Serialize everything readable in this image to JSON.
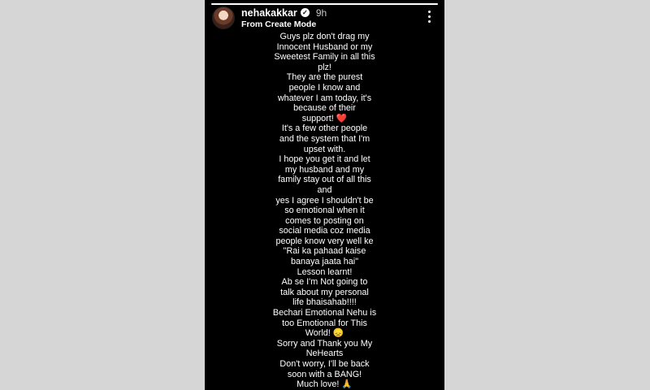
{
  "story": {
    "progress": 1.0,
    "header": {
      "username": "nehakakkar",
      "verified_glyph": "✓",
      "time": "9h",
      "subtitle": "From Create Mode"
    },
    "caption_lines": [
      "Guys plz don't drag my",
      "Innocent Husband or my",
      "Sweetest Family in all this",
      "plz!",
      "They are the purest",
      "people I know and",
      "whatever I am today, it's",
      "because of their",
      "support! ❤️",
      "It's a few other people",
      "and the system that I'm",
      "upset with.",
      "I hope you get it and let",
      "my husband and my",
      "family stay out of all this",
      "and",
      "yes I agree I shouldn't be",
      "so emotional when it",
      "comes to posting on",
      "social media coz media",
      "people know very well ke",
      "\"Rai ka pahaad kaise",
      "banaya jaata hai\"",
      "Lesson learnt!",
      "Ab se I'm Not going to",
      "talk about my personal",
      "life bhaisahab!!!!",
      "Bechari Emotional Nehu is",
      "too Emotional for This",
      "World! 😞",
      "Sorry and Thank you My",
      "NeHearts",
      "Don't worry, I'll be back",
      "soon with a BANG!",
      "Much love! 🙏"
    ]
  }
}
